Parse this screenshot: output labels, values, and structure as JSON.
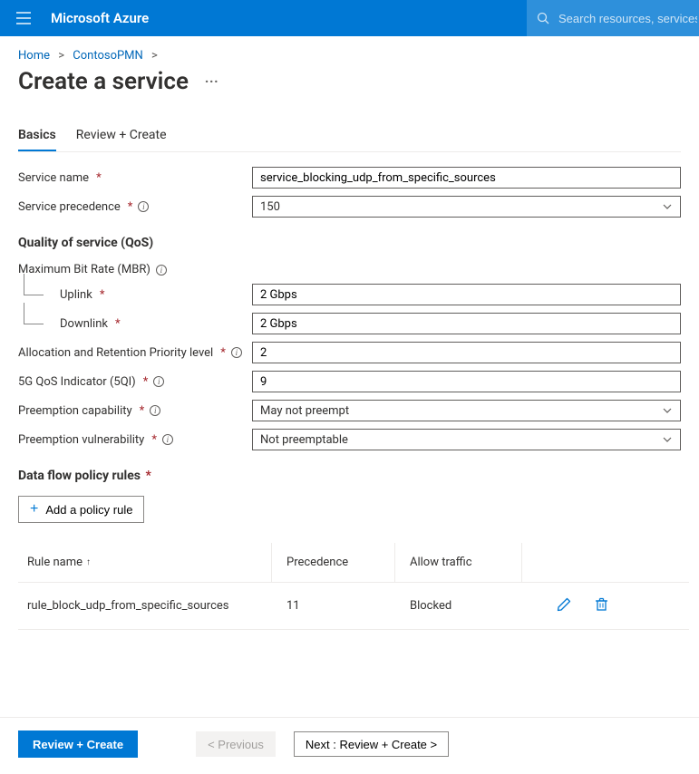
{
  "header": {
    "brand": "Microsoft Azure",
    "search_placeholder": "Search resources, services, and"
  },
  "breadcrumb": {
    "items": [
      "Home",
      "ContosoPMN"
    ]
  },
  "page": {
    "title": "Create a service"
  },
  "tabs": {
    "items": [
      {
        "label": "Basics",
        "active": true
      },
      {
        "label": "Review + Create",
        "active": false
      }
    ]
  },
  "form": {
    "service_name": {
      "label": "Service name",
      "value": "service_blocking_udp_from_specific_sources"
    },
    "service_precedence": {
      "label": "Service precedence",
      "value": "150"
    },
    "qos_section_title": "Quality of service (QoS)",
    "mbr_label": "Maximum Bit Rate (MBR)",
    "uplink": {
      "label": "Uplink",
      "value": "2 Gbps"
    },
    "downlink": {
      "label": "Downlink",
      "value": "2 Gbps"
    },
    "arp": {
      "label": "Allocation and Retention Priority level",
      "value": "2"
    },
    "fiveqi": {
      "label": "5G QoS Indicator (5QI)",
      "value": "9"
    },
    "preempt_cap": {
      "label": "Preemption capability",
      "value": "May not preempt"
    },
    "preempt_vuln": {
      "label": "Preemption vulnerability",
      "value": "Not preemptable"
    },
    "dfpr_section_title": "Data flow policy rules",
    "add_rule_label": "Add a policy rule"
  },
  "rules_table": {
    "headers": {
      "name": "Rule name",
      "precedence": "Precedence",
      "allow": "Allow traffic"
    },
    "rows": [
      {
        "name": "rule_block_udp_from_specific_sources",
        "precedence": "11",
        "allow": "Blocked"
      }
    ]
  },
  "footer": {
    "primary": "Review + Create",
    "previous": "< Previous",
    "next": "Next : Review + Create >"
  }
}
